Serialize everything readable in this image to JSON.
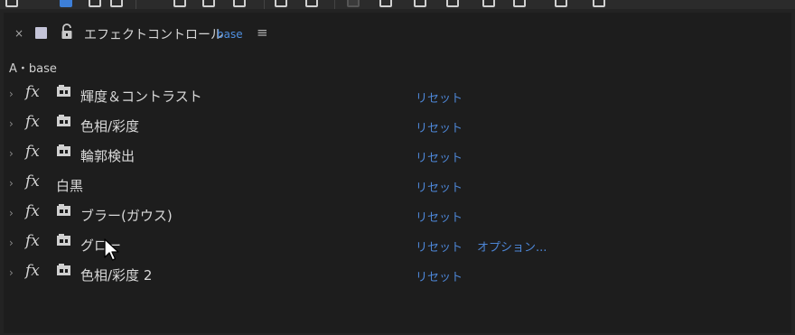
{
  "panel": {
    "tab_close": "×",
    "tab_title": "エフェクトコントロール",
    "tab_layer": "base",
    "tab_menu": "≡",
    "breadcrumb": "A・base"
  },
  "effects": [
    {
      "name": "輝度＆コントラスト",
      "reset": "リセット",
      "options": "",
      "badge": true
    },
    {
      "name": "色相/彩度",
      "reset": "リセット",
      "options": "",
      "badge": true
    },
    {
      "name": "輪郭検出",
      "reset": "リセット",
      "options": "",
      "badge": true
    },
    {
      "name": "白黒",
      "reset": "リセット",
      "options": "",
      "badge": false
    },
    {
      "name": "ブラー(ガウス)",
      "reset": "リセット",
      "options": "",
      "badge": true
    },
    {
      "name": "グロー",
      "reset": "リセット",
      "options": "オプション...",
      "badge": true
    },
    {
      "name": "色相/彩度 2",
      "reset": "リセット",
      "options": "",
      "badge": true
    }
  ],
  "icons": {
    "expand": "chevron-right-icon",
    "fx": "fx-icon",
    "badge": "accelerated-effect-badge-icon",
    "cursor": "mouse-pointer-icon"
  },
  "colors": {
    "panel_bg": "#1d1d1d",
    "link": "#4d86d6",
    "text": "#d8d8d8"
  }
}
